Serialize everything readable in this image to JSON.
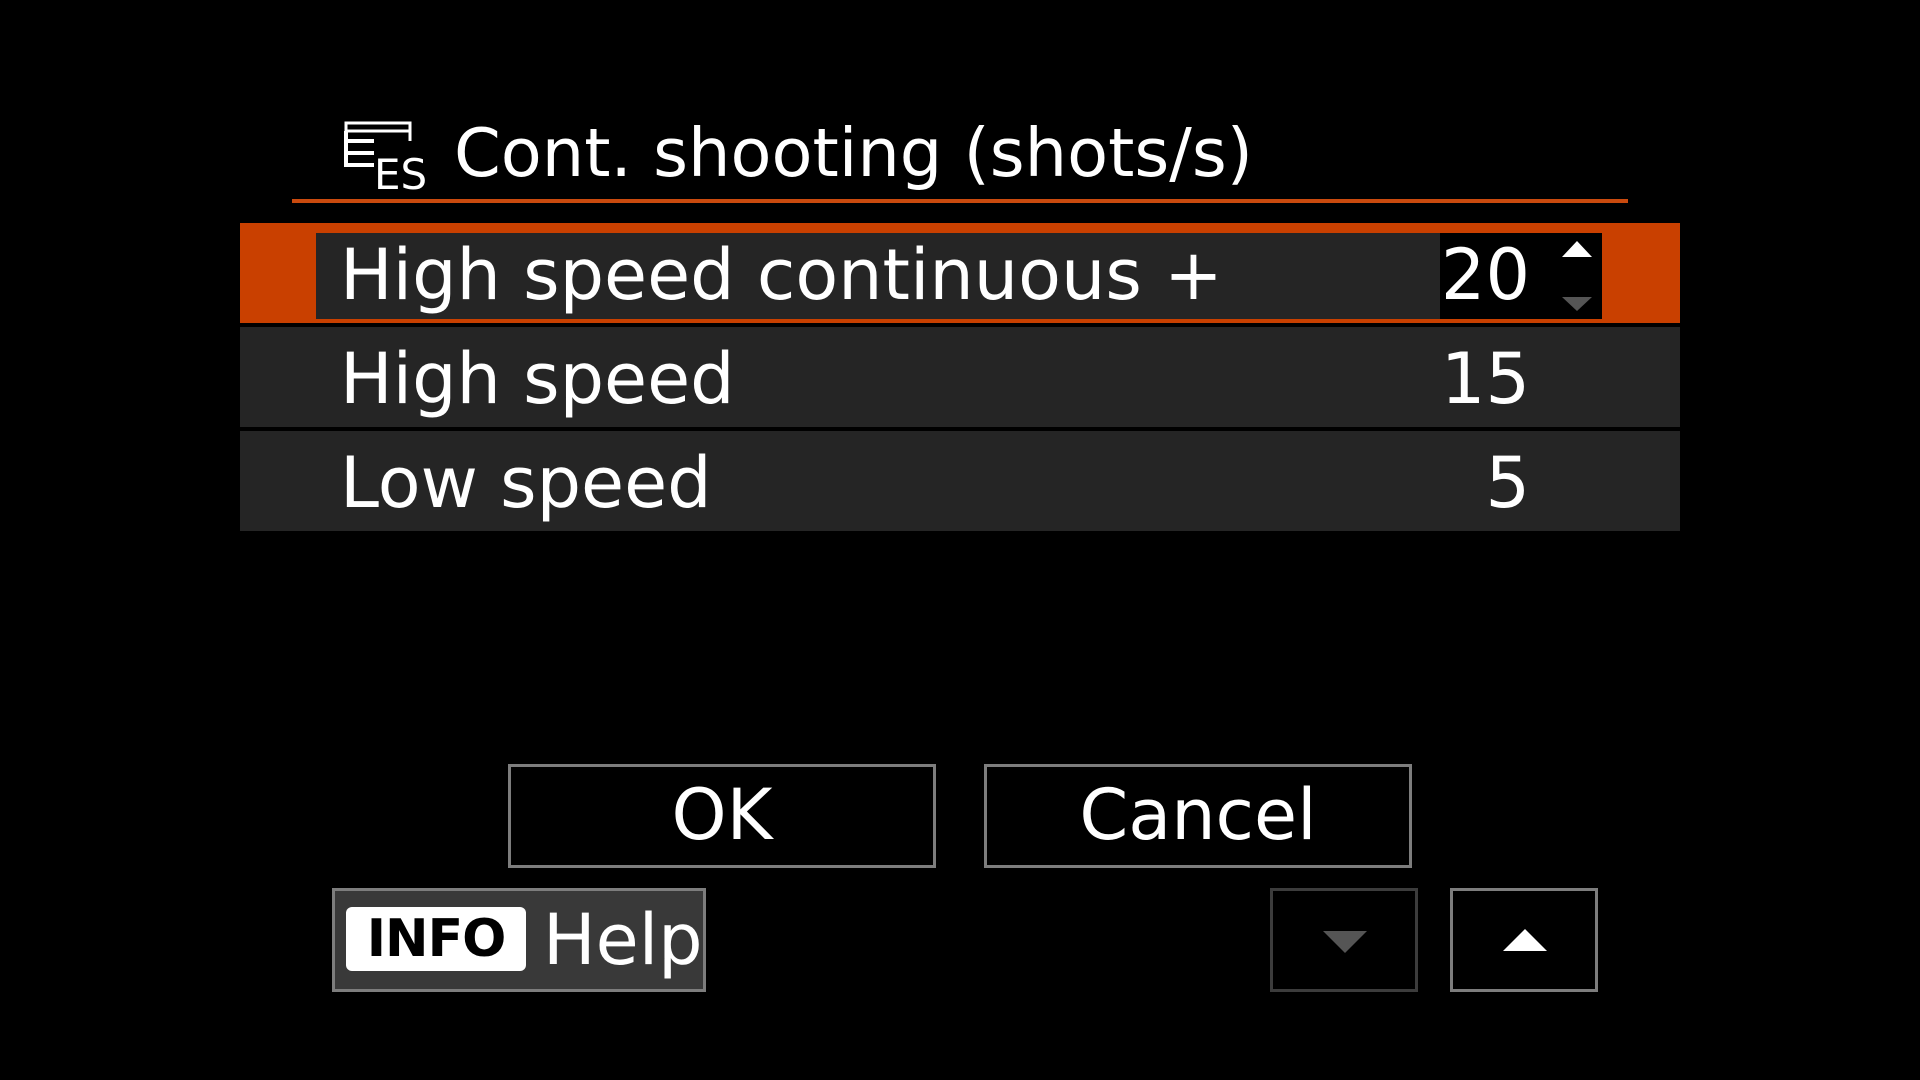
{
  "header": {
    "title": "Cont. shooting (shots/s)",
    "icon_name": "es-drive-mode-icon",
    "icon_text": "ES"
  },
  "options": [
    {
      "label": "High speed continuous +",
      "value": "20",
      "selected": true
    },
    {
      "label": "High speed",
      "value": "15",
      "selected": false
    },
    {
      "label": "Low speed",
      "value": "5",
      "selected": false
    }
  ],
  "buttons": {
    "ok_label": "OK",
    "cancel_label": "Cancel",
    "info_badge": "INFO",
    "help_label": "Help"
  },
  "colors": {
    "accent": "#c94000",
    "row_background": "#252525",
    "background": "#000000"
  }
}
